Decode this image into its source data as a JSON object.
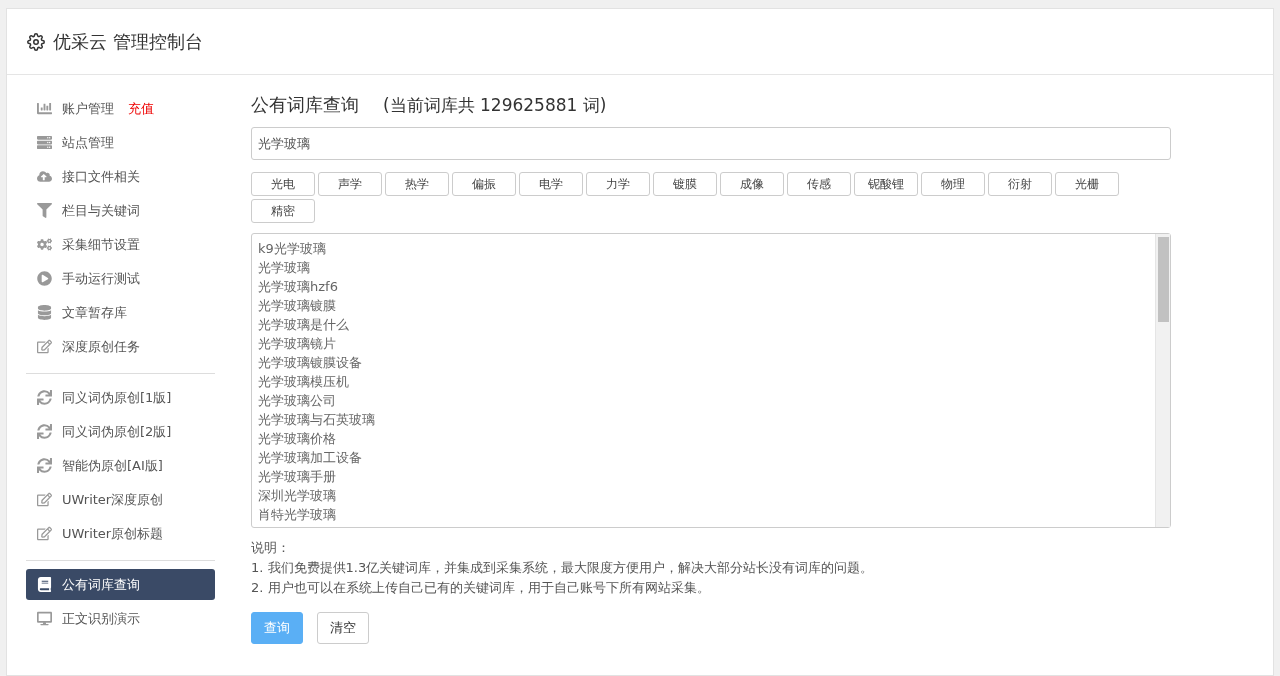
{
  "header": {
    "title": "优采云 管理控制台"
  },
  "sidebar": {
    "groups": [
      {
        "items": [
          {
            "label": "账户管理",
            "badge": "充值",
            "selected": false
          },
          {
            "label": "站点管理",
            "selected": false
          },
          {
            "label": "接口文件相关",
            "selected": false
          },
          {
            "label": "栏目与关键词",
            "selected": false
          },
          {
            "label": "采集细节设置",
            "selected": false
          },
          {
            "label": "手动运行测试",
            "selected": false
          },
          {
            "label": "文章暂存库",
            "selected": false
          },
          {
            "label": "深度原创任务",
            "selected": false
          }
        ]
      },
      {
        "items": [
          {
            "label": "同义词伪原创[1版]",
            "selected": false
          },
          {
            "label": "同义词伪原创[2版]",
            "selected": false
          },
          {
            "label": "智能伪原创[AI版]",
            "selected": false
          },
          {
            "label": "UWriter深度原创",
            "selected": false
          },
          {
            "label": "UWriter原创标题",
            "selected": false
          }
        ]
      },
      {
        "items": [
          {
            "label": "公有词库查询",
            "selected": true
          },
          {
            "label": "正文识别演示",
            "selected": false
          }
        ]
      }
    ]
  },
  "main": {
    "title": "公有词库查询",
    "subtitle": "(当前词库共 129625881 词)",
    "search": {
      "value": "光学玻璃"
    },
    "tags": [
      "光电",
      "声学",
      "热学",
      "偏振",
      "电学",
      "力学",
      "镀膜",
      "成像",
      "传感",
      "铌酸锂",
      "物理",
      "衍射",
      "光栅",
      "精密"
    ],
    "results": [
      "k9光学玻璃",
      "光学玻璃",
      "光学玻璃hzf6",
      "光学玻璃镀膜",
      "光学玻璃是什么",
      "光学玻璃镜片",
      "光学玻璃镀膜设备",
      "光学玻璃模压机",
      "光学玻璃公司",
      "光学玻璃与石英玻璃",
      "光学玻璃价格",
      "光学玻璃加工设备",
      "光学玻璃手册",
      "深圳光学玻璃",
      "肖特光学玻璃"
    ],
    "notes_title": "说明：",
    "notes": [
      "1. 我们免费提供1.3亿关键词库，并集成到采集系统，最大限度方便用户，解决大部分站长没有词库的问题。",
      "2. 用户也可以在系统上传自己已有的关键词库，用于自己账号下所有网站采集。"
    ],
    "buttons": [
      {
        "label": "查询",
        "kind": "primary"
      },
      {
        "label": "清空",
        "kind": "default"
      }
    ]
  }
}
